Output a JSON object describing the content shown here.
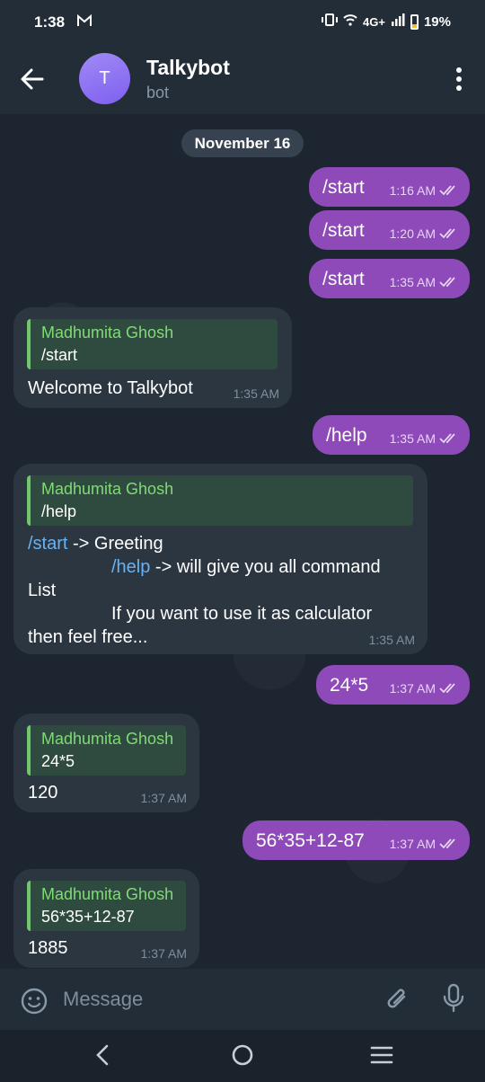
{
  "status_bar": {
    "time": "1:38",
    "network": "4G+",
    "battery": "19%"
  },
  "header": {
    "avatar_letter": "T",
    "title": "Talkybot",
    "subtitle": "bot"
  },
  "chat": {
    "date": "November 16",
    "messages": [
      {
        "text": "/start",
        "time": "1:16 AM"
      },
      {
        "text": "/start",
        "time": "1:20 AM"
      },
      {
        "text": "/start",
        "time": "1:35 AM"
      },
      {
        "reply_name": "Madhumita Ghosh",
        "reply_text": "/start",
        "text": "Welcome to Talkybot",
        "time": "1:35 AM"
      },
      {
        "text": "/help",
        "time": "1:35 AM"
      },
      {
        "reply_name": "Madhumita Ghosh",
        "reply_text": "/help",
        "lines": [
          {
            "cmd": "/start",
            "rest": " -> Greeting"
          },
          {
            "cmd": "/help",
            "rest": " -> will give you all command"
          },
          {
            "text": "List"
          },
          {
            "text": "If you want to use it as calculator"
          },
          {
            "text": "then feel free..."
          }
        ],
        "time": "1:35 AM"
      },
      {
        "text": "24*5",
        "time": "1:37 AM"
      },
      {
        "reply_name": "Madhumita Ghosh",
        "reply_text": "24*5",
        "text": "120",
        "time": "1:37 AM"
      },
      {
        "text": "56*35+12-87",
        "time": "1:37 AM"
      },
      {
        "reply_name": "Madhumita Ghosh",
        "reply_text": "56*35+12-87",
        "text": "1885",
        "time": "1:37 AM"
      }
    ]
  },
  "composer": {
    "placeholder": "Message"
  },
  "colors": {
    "outgoing_bubble": "#8e4ab8",
    "incoming_bubble": "#2b3641",
    "reply_name": "#82d978",
    "command_link": "#6ab2f2"
  }
}
